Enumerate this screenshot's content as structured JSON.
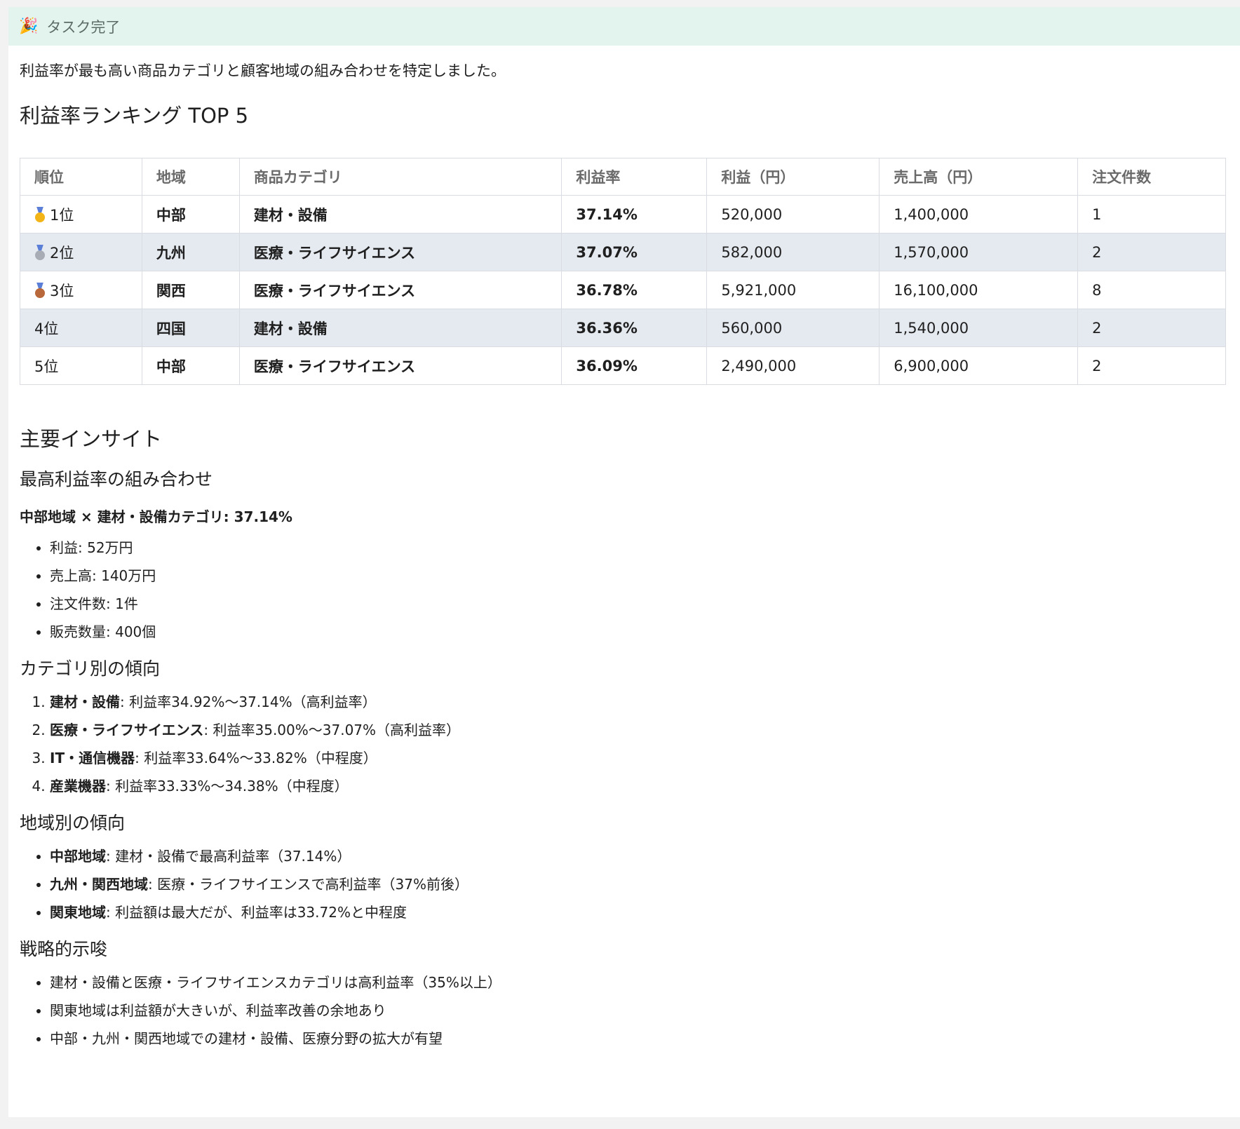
{
  "banner": {
    "icon": "party-popper-icon",
    "title": "タスク完了"
  },
  "intro": "利益率が最も高い商品カテゴリと顧客地域の組み合わせを特定しました。",
  "ranking": {
    "title": "利益率ランキング TOP 5",
    "headers": [
      "順位",
      "地域",
      "商品カテゴリ",
      "利益率",
      "利益（円）",
      "売上高（円）",
      "注文件数"
    ],
    "rows": [
      {
        "medal": "gold",
        "rank": "1位",
        "region": "中部",
        "category": "建材・設備",
        "margin": "37.14%",
        "profit": "520,000",
        "sales": "1,400,000",
        "orders": "1"
      },
      {
        "medal": "silver",
        "rank": "2位",
        "region": "九州",
        "category": "医療・ライフサイエンス",
        "margin": "37.07%",
        "profit": "582,000",
        "sales": "1,570,000",
        "orders": "2"
      },
      {
        "medal": "bronze",
        "rank": "3位",
        "region": "関西",
        "category": "医療・ライフサイエンス",
        "margin": "36.78%",
        "profit": "5,921,000",
        "sales": "16,100,000",
        "orders": "8"
      },
      {
        "medal": "",
        "rank": "4位",
        "region": "四国",
        "category": "建材・設備",
        "margin": "36.36%",
        "profit": "560,000",
        "sales": "1,540,000",
        "orders": "2"
      },
      {
        "medal": "",
        "rank": "5位",
        "region": "中部",
        "category": "医療・ライフサイエンス",
        "margin": "36.09%",
        "profit": "2,490,000",
        "sales": "6,900,000",
        "orders": "2"
      }
    ],
    "medal_colors": {
      "gold": "#f2b417",
      "silver": "#a8adb5",
      "bronze": "#b8683a"
    }
  },
  "insights": {
    "title": "主要インサイト",
    "best": {
      "title": "最高利益率の組み合わせ",
      "highlight": "中部地域 × 建材・設備カテゴリ: 37.14%",
      "items": [
        "利益: 52万円",
        "売上高: 140万円",
        "注文件数: 1件",
        "販売数量: 400個"
      ]
    },
    "category_trends": {
      "title": "カテゴリ別の傾向",
      "items": [
        {
          "label": "建材・設備",
          "text": ": 利益率34.92%〜37.14%（高利益率）"
        },
        {
          "label": "医療・ライフサイエンス",
          "text": ": 利益率35.00%〜37.07%（高利益率）"
        },
        {
          "label": "IT・通信機器",
          "text": ": 利益率33.64%〜33.82%（中程度）"
        },
        {
          "label": "産業機器",
          "text": ": 利益率33.33%〜34.38%（中程度）"
        }
      ]
    },
    "region_trends": {
      "title": "地域別の傾向",
      "items": [
        {
          "label": "中部地域",
          "text": ": 建材・設備で最高利益率（37.14%）"
        },
        {
          "label": "九州・関西地域",
          "text": ": 医療・ライフサイエンスで高利益率（37%前後）"
        },
        {
          "label": "関東地域",
          "text": ": 利益額は最大だが、利益率は33.72%と中程度"
        }
      ]
    },
    "strategy": {
      "title": "戦略的示唆",
      "items": [
        "建材・設備と医療・ライフサイエンスカテゴリは高利益率（35%以上）",
        "関東地域は利益額が大きいが、利益率改善の余地あり",
        "中部・九州・関西地域での建材・設備、医療分野の拡大が有望"
      ]
    }
  }
}
